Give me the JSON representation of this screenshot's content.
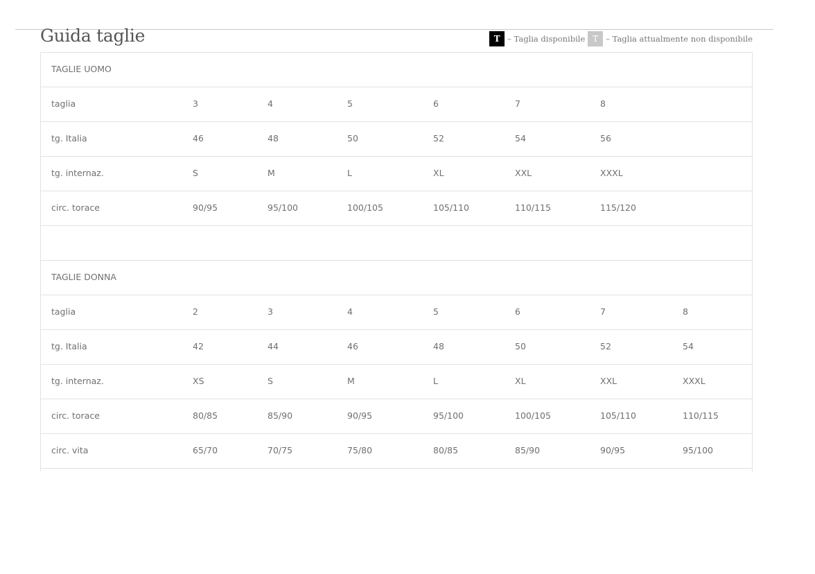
{
  "title": "Guida taglie",
  "legend": {
    "available_swatch": "T",
    "available_label": "– Taglia disponibile",
    "unavailable_swatch": "T",
    "unavailable_label": "– Taglia attualmente non disponibile"
  },
  "men": {
    "heading": "TAGLIE UOMO",
    "rows": [
      {
        "label": "taglia",
        "values": [
          "3",
          "4",
          "5",
          "6",
          "7",
          "8"
        ]
      },
      {
        "label": "tg. Italia",
        "values": [
          "46",
          "48",
          "50",
          "52",
          "54",
          "56"
        ]
      },
      {
        "label": "tg. internaz.",
        "values": [
          "S",
          "M",
          "L",
          "XL",
          "XXL",
          "XXXL"
        ]
      },
      {
        "label": "circ. torace",
        "values": [
          "90/95",
          "95/100",
          "100/105",
          "105/110",
          "110/115",
          "115/120"
        ]
      }
    ]
  },
  "women": {
    "heading": "TAGLIE DONNA",
    "rows": [
      {
        "label": "taglia",
        "values": [
          "2",
          "3",
          "4",
          "5",
          "6",
          "7",
          "8"
        ]
      },
      {
        "label": "tg. Italia",
        "values": [
          "42",
          "44",
          "46",
          "48",
          "50",
          "52",
          "54"
        ]
      },
      {
        "label": "tg. internaz.",
        "values": [
          "XS",
          "S",
          "M",
          "L",
          "XL",
          "XXL",
          "XXXL"
        ]
      },
      {
        "label": "circ. torace",
        "values": [
          "80/85",
          "85/90",
          "90/95",
          "95/100",
          "100/105",
          "105/110",
          "110/115"
        ]
      },
      {
        "label": "circ. vita",
        "values": [
          "65/70",
          "70/75",
          "75/80",
          "80/85",
          "85/90",
          "90/95",
          "95/100"
        ]
      }
    ]
  },
  "colors": {
    "available": "#000000",
    "unavailable": "#c8c8c8",
    "text": "#6f6f6f",
    "border": "#e2e2e2"
  }
}
